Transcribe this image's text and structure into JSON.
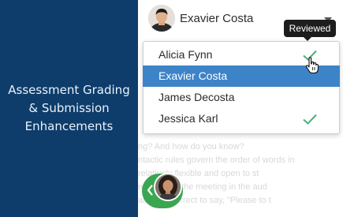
{
  "sidebar": {
    "title": "Assessment Grading\n& Submission\nEnhancements"
  },
  "student_selector": {
    "current_name": "Exavier Costa",
    "caret_icon": "caret-down-icon"
  },
  "dropdown": {
    "items": [
      {
        "name": "Alicia Fynn",
        "reviewed": true,
        "selected": false
      },
      {
        "name": "Exavier Costa",
        "reviewed": false,
        "selected": true
      },
      {
        "name": "James Decosta",
        "reviewed": false,
        "selected": false
      },
      {
        "name": "Jessica Karl",
        "reviewed": true,
        "selected": false
      }
    ]
  },
  "tooltip": {
    "text": "Reviewed"
  },
  "background_text": {
    "lines": [
      "ng? And how do you know?",
      "ntactic rules govern the order of words in",
      "relatively flexible and open to st",
      "re come to the meeting in the aud",
      "ald be incorrect to say, \"Please to t"
    ]
  },
  "colors": {
    "sidebar_bg": "#0e3d6b",
    "selected_bg": "#3d83c7",
    "check_green": "#4caf7d",
    "back_tab_green": "#3aa651"
  },
  "icons": {
    "check": "check-icon",
    "cursor": "hand-pointer-icon",
    "back": "chevron-left-icon"
  }
}
